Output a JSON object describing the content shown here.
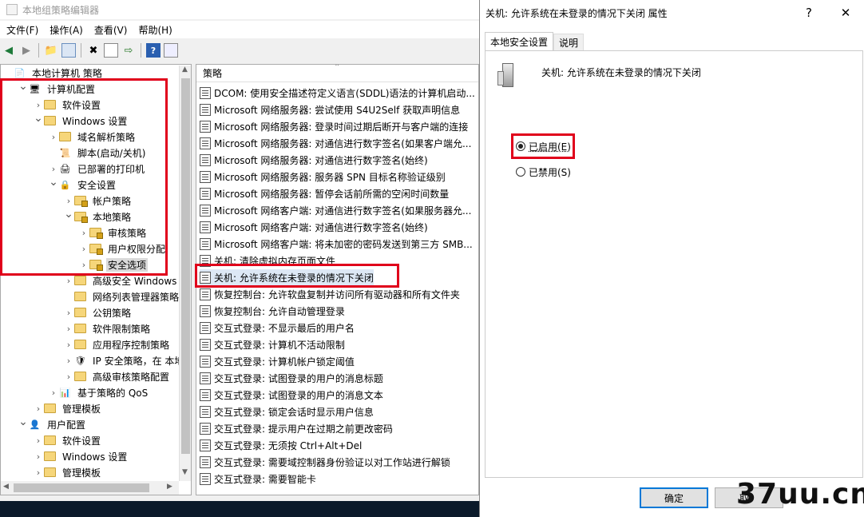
{
  "main": {
    "title": "本地组策略编辑器",
    "menu": [
      "文件(F)",
      "操作(A)",
      "查看(V)",
      "帮助(H)"
    ],
    "toolbar_icons": [
      "back-icon",
      "forward-icon",
      "up-folder-icon",
      "show-tree-icon",
      "delete-icon",
      "properties-icon",
      "export-icon",
      "help-icon",
      "view-icon"
    ]
  },
  "tree": [
    {
      "label": "本地计算机 策略",
      "indent": 0,
      "toggle": "",
      "icon": "policy"
    },
    {
      "label": "计算机配置",
      "indent": 1,
      "toggle": "v",
      "icon": "computer"
    },
    {
      "label": "软件设置",
      "indent": 2,
      "toggle": ">",
      "icon": "folder"
    },
    {
      "label": "Windows 设置",
      "indent": 2,
      "toggle": "v",
      "icon": "folder"
    },
    {
      "label": "域名解析策略",
      "indent": 3,
      "toggle": ">",
      "icon": "folder"
    },
    {
      "label": "脚本(启动/关机)",
      "indent": 3,
      "toggle": "",
      "icon": "script"
    },
    {
      "label": "已部署的打印机",
      "indent": 3,
      "toggle": ">",
      "icon": "printer"
    },
    {
      "label": "安全设置",
      "indent": 3,
      "toggle": "v",
      "icon": "security"
    },
    {
      "label": "帐户策略",
      "indent": 4,
      "toggle": ">",
      "icon": "lockfolder"
    },
    {
      "label": "本地策略",
      "indent": 4,
      "toggle": "v",
      "icon": "lockfolder"
    },
    {
      "label": "审核策略",
      "indent": 5,
      "toggle": ">",
      "icon": "lockfolder"
    },
    {
      "label": "用户权限分配",
      "indent": 5,
      "toggle": ">",
      "icon": "lockfolder"
    },
    {
      "label": "安全选项",
      "indent": 5,
      "toggle": ">",
      "icon": "lockfolder",
      "selected": true
    },
    {
      "label": "高级安全 Windows 防",
      "indent": 4,
      "toggle": ">",
      "icon": "folder"
    },
    {
      "label": "网络列表管理器策略",
      "indent": 4,
      "toggle": "",
      "icon": "folder"
    },
    {
      "label": "公钥策略",
      "indent": 4,
      "toggle": ">",
      "icon": "folder"
    },
    {
      "label": "软件限制策略",
      "indent": 4,
      "toggle": ">",
      "icon": "folder"
    },
    {
      "label": "应用程序控制策略",
      "indent": 4,
      "toggle": ">",
      "icon": "folder"
    },
    {
      "label": "IP 安全策略，在 本地计",
      "indent": 4,
      "toggle": ">",
      "icon": "ipsec"
    },
    {
      "label": "高级审核策略配置",
      "indent": 4,
      "toggle": ">",
      "icon": "folder"
    },
    {
      "label": "基于策略的 QoS",
      "indent": 3,
      "toggle": ">",
      "icon": "chart"
    },
    {
      "label": "管理模板",
      "indent": 2,
      "toggle": ">",
      "icon": "folder"
    },
    {
      "label": "用户配置",
      "indent": 1,
      "toggle": "v",
      "icon": "user"
    },
    {
      "label": "软件设置",
      "indent": 2,
      "toggle": ">",
      "icon": "folder"
    },
    {
      "label": "Windows 设置",
      "indent": 2,
      "toggle": ">",
      "icon": "folder"
    },
    {
      "label": "管理模板",
      "indent": 2,
      "toggle": ">",
      "icon": "folder"
    }
  ],
  "list": {
    "header": "策略",
    "rows": [
      "DCOM: 使用安全描述符定义语言(SDDL)语法的计算机启动...",
      "Microsoft 网络服务器: 尝试使用 S4U2Self 获取声明信息",
      "Microsoft 网络服务器: 登录时间过期后断开与客户端的连接",
      "Microsoft 网络服务器: 对通信进行数字签名(如果客户端允...",
      "Microsoft 网络服务器: 对通信进行数字签名(始终)",
      "Microsoft 网络服务器: 服务器 SPN 目标名称验证级别",
      "Microsoft 网络服务器: 暂停会话前所需的空闲时间数量",
      "Microsoft 网络客户端: 对通信进行数字签名(如果服务器允...",
      "Microsoft 网络客户端: 对通信进行数字签名(始终)",
      "Microsoft 网络客户端: 将未加密的密码发送到第三方 SMB...",
      "关机: 清除虚拟内存页面文件",
      "关机: 允许系统在未登录的情况下关闭",
      "恢复控制台: 允许软盘复制并访问所有驱动器和所有文件夹",
      "恢复控制台: 允许自动管理登录",
      "交互式登录: 不显示最后的用户名",
      "交互式登录: 计算机不活动限制",
      "交互式登录: 计算机帐户锁定阈值",
      "交互式登录: 试图登录的用户的消息标题",
      "交互式登录: 试图登录的用户的消息文本",
      "交互式登录: 锁定会话时显示用户信息",
      "交互式登录: 提示用户在过期之前更改密码",
      "交互式登录: 无须按 Ctrl+Alt+Del",
      "交互式登录: 需要域控制器身份验证以对工作站进行解锁",
      "交互式登录: 需要智能卡"
    ]
  },
  "dialog": {
    "title": "关机: 允许系统在未登录的情况下关闭 属性",
    "help": "?",
    "close": "✕",
    "tabs": [
      "本地安全设置",
      "说明"
    ],
    "policy_name": "关机: 允许系统在未登录的情况下关闭",
    "radio_enabled": "已启用(E)",
    "radio_disabled": "已禁用(S)",
    "selected": "enabled",
    "ok": "确定",
    "cancel": "取"
  },
  "watermark": "37uu.cn"
}
